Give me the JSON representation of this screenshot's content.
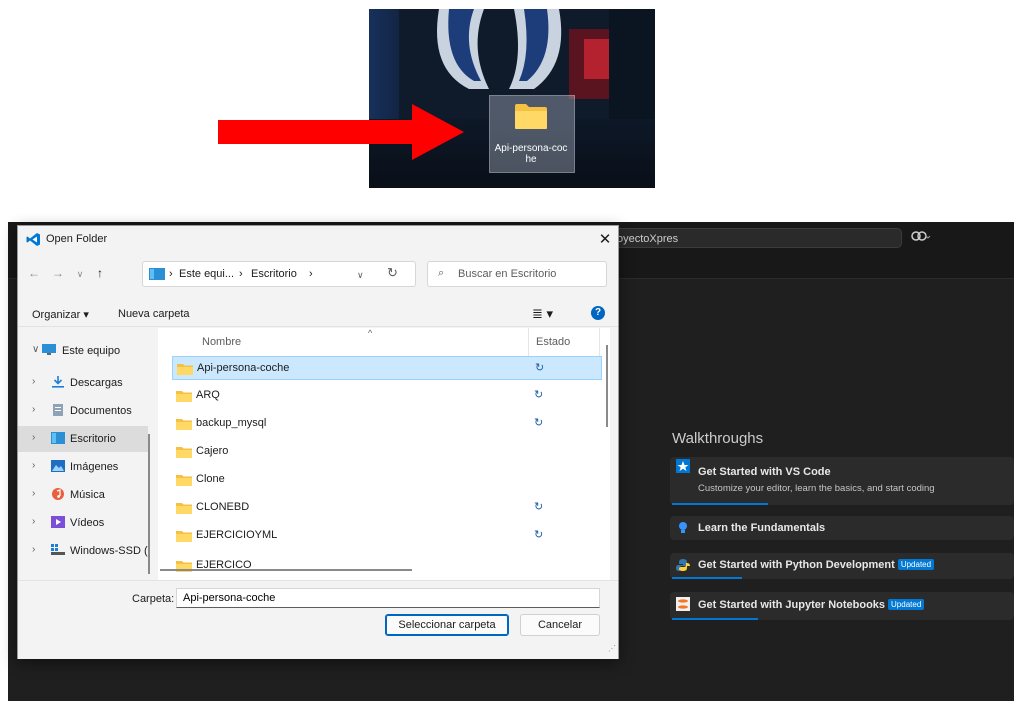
{
  "desktop": {
    "folder_label": "Api-persona-coche",
    "folder_label_line1": "Api-persona-coc",
    "folder_label_line2": "he",
    "arrow_color": "#ff0000"
  },
  "vscode": {
    "search_text": "oyectoXpres",
    "copilot_icon": "copilot-icon",
    "walkthroughs_title": "Walkthroughs",
    "walkthroughs": [
      {
        "title": "Get Started with VS Code",
        "description": "Customize your editor, learn the basics, and start coding",
        "badge": "",
        "icon": "star-icon",
        "progress": 0.28
      },
      {
        "title": "Learn the Fundamentals",
        "description": "",
        "badge": "",
        "icon": "lightbulb-icon",
        "progress": 0
      },
      {
        "title": "Get Started with Python Development",
        "description": "",
        "badge": "Updated",
        "icon": "python-icon",
        "progress": 0.2
      },
      {
        "title": "Get Started with Jupyter Notebooks",
        "description": "",
        "badge": "Updated",
        "icon": "jupyter-icon",
        "progress": 0.25
      }
    ]
  },
  "dialog": {
    "title": "Open Folder",
    "address": {
      "crumbs": [
        "Este equi...",
        "Escritorio"
      ]
    },
    "search_placeholder": "Buscar en Escritorio",
    "toolbar": {
      "organize": "Organizar ▾",
      "new_folder": "Nueva carpeta",
      "help": "?"
    },
    "nav": [
      {
        "label": "Este equipo",
        "icon": "computer-icon",
        "expanded": true
      },
      {
        "label": "Descargas",
        "icon": "download-icon"
      },
      {
        "label": "Documentos",
        "icon": "documents-icon"
      },
      {
        "label": "Escritorio",
        "icon": "desktop-icon",
        "selected": true
      },
      {
        "label": "Imágenes",
        "icon": "pictures-icon"
      },
      {
        "label": "Música",
        "icon": "music-icon"
      },
      {
        "label": "Vídeos",
        "icon": "videos-icon"
      },
      {
        "label": "Windows-SSD (",
        "icon": "drive-icon"
      }
    ],
    "columns": {
      "name": "Nombre",
      "status": "Estado"
    },
    "rows": [
      {
        "name": "Api-persona-coche",
        "sync": true,
        "selected": true
      },
      {
        "name": "ARQ",
        "sync": true
      },
      {
        "name": "backup_mysql",
        "sync": true
      },
      {
        "name": "Cajero",
        "sync": false
      },
      {
        "name": "Clone",
        "sync": false
      },
      {
        "name": "CLONEBD",
        "sync": true
      },
      {
        "name": "EJERCICIOYML",
        "sync": true
      },
      {
        "name": "EJERCICO",
        "sync": false
      }
    ],
    "folder_label": "Carpeta:",
    "folder_value": "Api-persona-coche",
    "select_button": "Seleccionar carpeta",
    "cancel_button": "Cancelar"
  }
}
